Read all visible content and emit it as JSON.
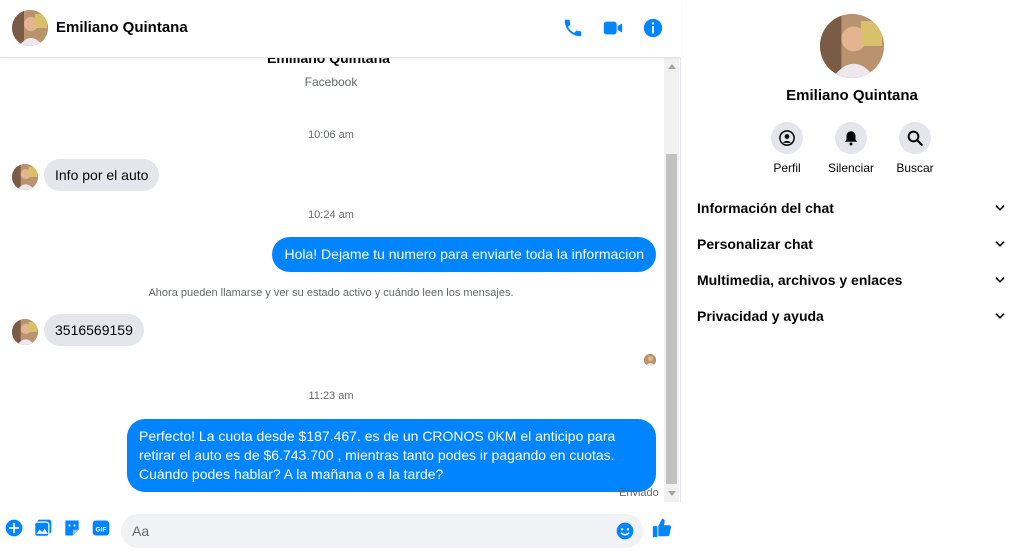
{
  "contact": {
    "name": "Emiliano Quintana",
    "source": "Facebook"
  },
  "header": {
    "call_icon": "phone-icon",
    "video_icon": "video-camera-icon",
    "info_icon": "info-icon"
  },
  "messages": {
    "t1": "10:06 am",
    "m1": "Info por el auto",
    "t2": "10:24 am",
    "m2": "Hola! Dejame tu numero  para enviarte toda la informacion",
    "notice": "Ahora pueden llamarse y ver su estado activo y cuándo leen los mensajes.",
    "m3": "3516569159",
    "t3": "11:23 am",
    "m4": "Perfecto! La cuota desde $187.467. es de un CRONOS 0KM el anticipo para retirar el auto es de $6.743.700 , mientras tanto podes ir pagando en cuotas. Cuándo podes hablar? A la mañana o a la tarde?",
    "status": "Enviado"
  },
  "composer": {
    "placeholder": "Aa"
  },
  "panel": {
    "name": "Emiliano Quintana",
    "actions": {
      "profile": "Perfil",
      "mute": "Silenciar",
      "search": "Buscar"
    },
    "sections": {
      "chat_info": "Información del chat",
      "customize": "Personalizar chat",
      "media": "Multimedia, archivos y enlaces",
      "privacy": "Privacidad y ayuda"
    }
  },
  "colors": {
    "accent": "#0084ff",
    "incoming_bubble": "#e4e6eb",
    "muted_text": "#65676b"
  }
}
